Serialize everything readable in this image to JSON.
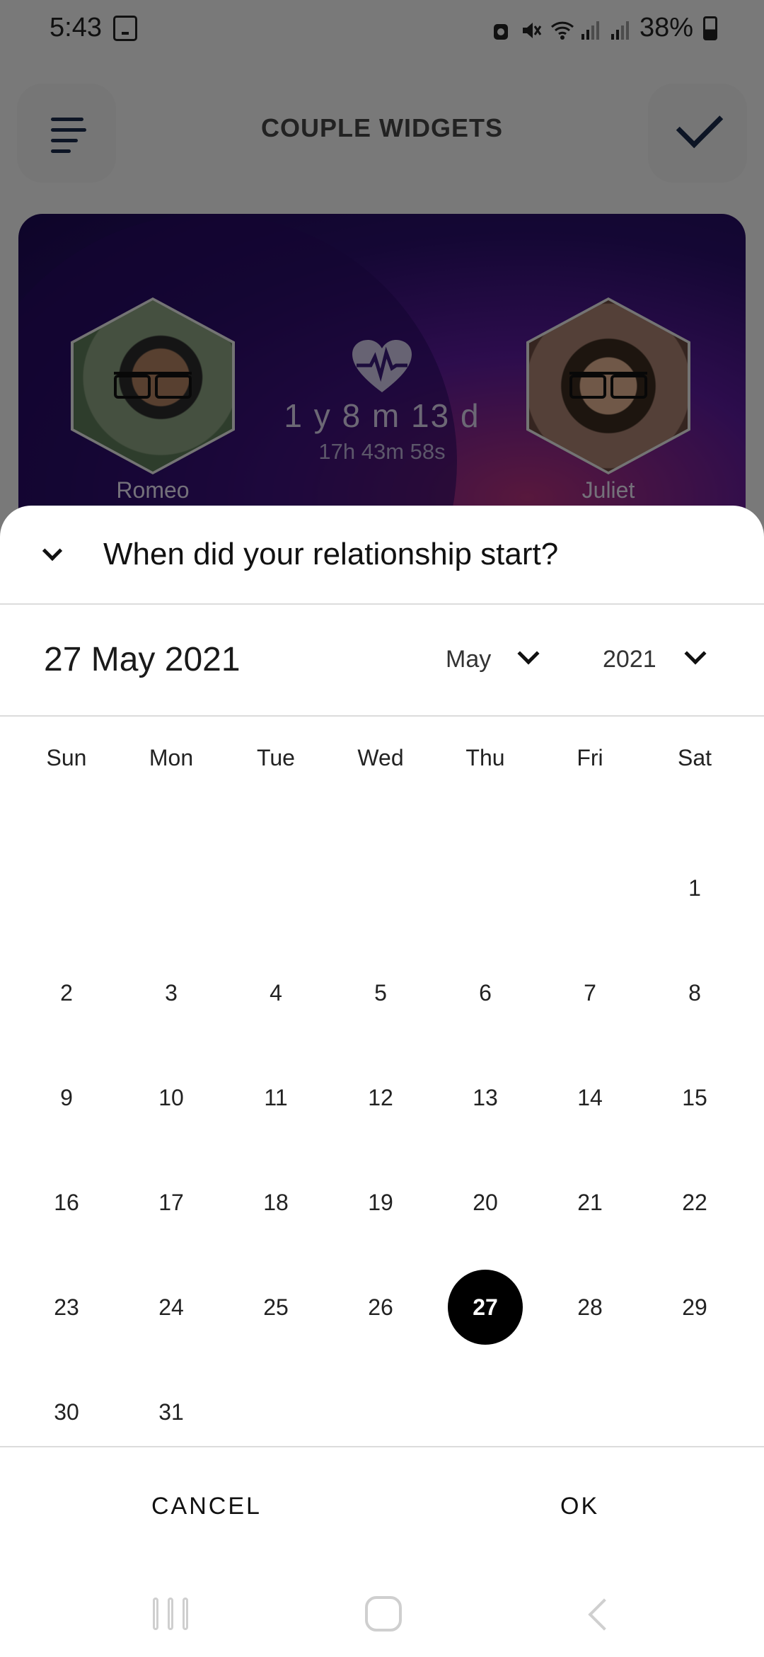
{
  "status_bar": {
    "time": "5:43",
    "battery": "38%"
  },
  "app_bar": {
    "title": "COUPLE WIDGETS"
  },
  "couple_card": {
    "left_name": "Romeo",
    "right_name": "Juliet",
    "duration": "1 y 8 m 13 d",
    "duration_time": "17h 43m 58s"
  },
  "sheet": {
    "title": "When did your relationship start?",
    "selected_date": "27 May 2021",
    "month": "May",
    "year": "2021",
    "weekdays": [
      "Sun",
      "Mon",
      "Tue",
      "Wed",
      "Thu",
      "Fri",
      "Sat"
    ],
    "weeks": [
      [
        "",
        "",
        "",
        "",
        "",
        "",
        "1"
      ],
      [
        "2",
        "3",
        "4",
        "5",
        "6",
        "7",
        "8"
      ],
      [
        "9",
        "10",
        "11",
        "12",
        "13",
        "14",
        "15"
      ],
      [
        "16",
        "17",
        "18",
        "19",
        "20",
        "21",
        "22"
      ],
      [
        "23",
        "24",
        "25",
        "26",
        "27",
        "28",
        "29"
      ],
      [
        "30",
        "31",
        "",
        "",
        "",
        "",
        ""
      ]
    ],
    "selected_day": "27",
    "cancel_label": "CANCEL",
    "ok_label": "OK"
  }
}
